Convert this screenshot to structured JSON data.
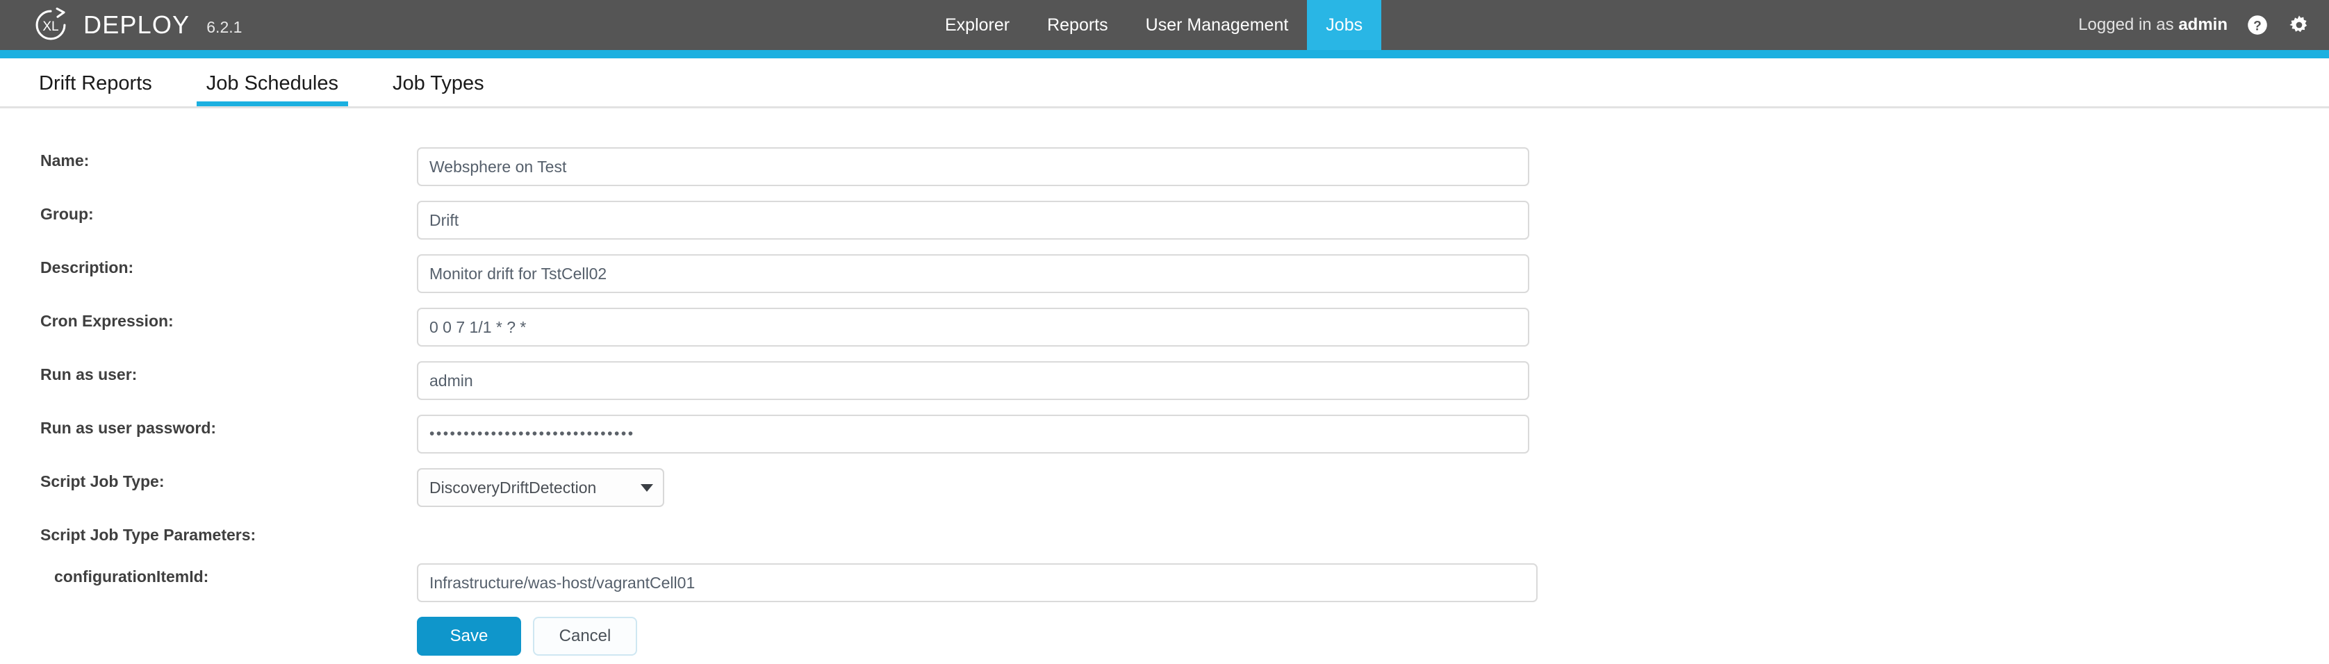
{
  "header": {
    "brand": "DEPLOY",
    "version": "6.2.1",
    "logo_icon": "xl-circular-arrow-logo",
    "nav": [
      {
        "label": "Explorer",
        "active": false
      },
      {
        "label": "Reports",
        "active": false
      },
      {
        "label": "User Management",
        "active": false
      },
      {
        "label": "Jobs",
        "active": true
      }
    ],
    "logged_in_prefix": "Logged in as ",
    "logged_in_user": "admin",
    "help_icon": "question-circle-icon",
    "settings_icon": "gear-icon",
    "accent_color": "#1cb0e0",
    "bar_color": "#555555"
  },
  "tabs": [
    {
      "label": "Drift Reports",
      "active": false
    },
    {
      "label": "Job Schedules",
      "active": true
    },
    {
      "label": "Job Types",
      "active": false
    }
  ],
  "form": {
    "name": {
      "label": "Name:",
      "value": "Websphere on Test"
    },
    "group": {
      "label": "Group:",
      "value": "Drift"
    },
    "description": {
      "label": "Description:",
      "value": "Monitor drift for TstCell02"
    },
    "cron": {
      "label": "Cron Expression:",
      "value": "0 0 7 1/1 * ? *"
    },
    "run_as_user": {
      "label": "Run as user:",
      "value": "admin"
    },
    "run_as_user_password": {
      "label": "Run as user password:",
      "value": "••••••••••••••••••••••••••••••"
    },
    "script_job_type": {
      "label": "Script Job Type:",
      "value": "DiscoveryDriftDetection",
      "caret_icon": "chevron-down-icon"
    },
    "script_job_type_parameters": {
      "label": "Script Job Type Parameters:"
    },
    "configuration_item_id": {
      "label": "configurationItemId:",
      "value": "Infrastructure/was-host/vagrantCell01"
    },
    "save_label": "Save",
    "cancel_label": "Cancel",
    "save_color": "#0f96cb"
  }
}
